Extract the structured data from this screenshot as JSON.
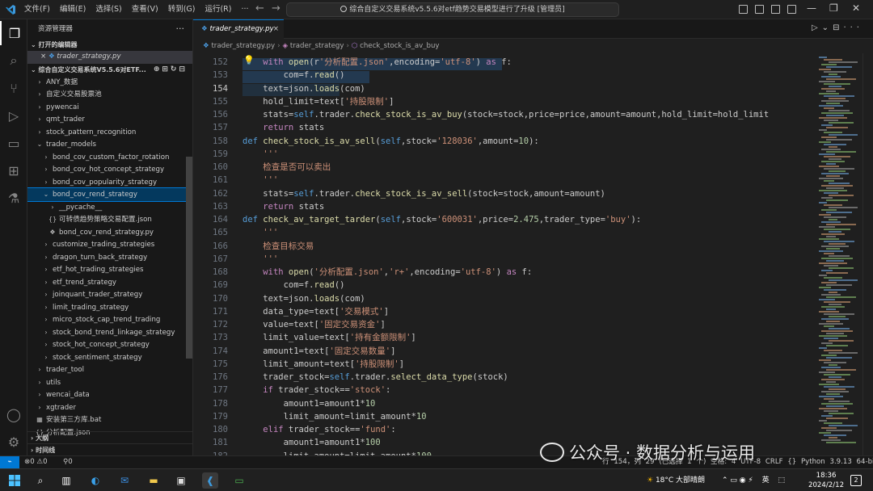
{
  "menu": [
    "文件(F)",
    "编辑(E)",
    "选择(S)",
    "查看(V)",
    "转到(G)",
    "运行(R)",
    "···"
  ],
  "command_center": "综合自定义交易系统v5.5.6对etf趋势交易模型进行了升级 [管理员]",
  "sidebar": {
    "title": "资源管理器",
    "open_editors_header": "打开的编辑器",
    "open_editor_file": "trader_strategy.py",
    "workspace_header": "综合自定义交易系统V5.5.6对ETF...",
    "tree": [
      {
        "label": "ANY_数据",
        "indent": 2,
        "kind": "folder",
        "chev": "›"
      },
      {
        "label": "自定义交易股票池",
        "indent": 2,
        "kind": "folder",
        "chev": "›"
      },
      {
        "label": "pywencai",
        "indent": 2,
        "kind": "folder",
        "chev": "›"
      },
      {
        "label": "qmt_trader",
        "indent": 2,
        "kind": "folder",
        "chev": "›"
      },
      {
        "label": "stock_pattern_recognition",
        "indent": 2,
        "kind": "folder",
        "chev": "›"
      },
      {
        "label": "trader_models",
        "indent": 2,
        "kind": "folder",
        "chev": "⌄"
      },
      {
        "label": "bond_cov_custom_factor_rotation",
        "indent": 3,
        "kind": "folder",
        "chev": "›"
      },
      {
        "label": "bond_cov_hot_concept_strategy",
        "indent": 3,
        "kind": "folder",
        "chev": "›"
      },
      {
        "label": "bond_cov_popularity_strategy",
        "indent": 3,
        "kind": "folder",
        "chev": "›"
      },
      {
        "label": "bond_cov_rend_strategy",
        "indent": 3,
        "kind": "folder",
        "chev": "⌄",
        "state": "sel"
      },
      {
        "label": "__pycache__",
        "indent": 4,
        "kind": "folder",
        "chev": "›"
      },
      {
        "label": "可转债趋势策略交易配置.json",
        "indent": 4,
        "kind": "json",
        "chev": ""
      },
      {
        "label": "bond_cov_rend_strategy.py",
        "indent": 4,
        "kind": "py",
        "chev": ""
      },
      {
        "label": "customize_trading_strategies",
        "indent": 3,
        "kind": "folder",
        "chev": "›"
      },
      {
        "label": "dragon_turn_back_strategy",
        "indent": 3,
        "kind": "folder",
        "chev": "›"
      },
      {
        "label": "etf_hot_trading_strategies",
        "indent": 3,
        "kind": "folder",
        "chev": "›"
      },
      {
        "label": "etf_trend_strategy",
        "indent": 3,
        "kind": "folder",
        "chev": "›"
      },
      {
        "label": "joinquant_trader_strategy",
        "indent": 3,
        "kind": "folder",
        "chev": "›"
      },
      {
        "label": "limit_trading_strategy",
        "indent": 3,
        "kind": "folder",
        "chev": "›"
      },
      {
        "label": "micro_stock_cap_trend_trading",
        "indent": 3,
        "kind": "folder",
        "chev": "›"
      },
      {
        "label": "stock_bond_trend_linkage_strategy",
        "indent": 3,
        "kind": "folder",
        "chev": "›"
      },
      {
        "label": "stock_hot_concept_strategy",
        "indent": 3,
        "kind": "folder",
        "chev": "›"
      },
      {
        "label": "stock_sentiment_strategy",
        "indent": 3,
        "kind": "folder",
        "chev": "›"
      },
      {
        "label": "trader_tool",
        "indent": 2,
        "kind": "folder",
        "chev": "›"
      },
      {
        "label": "utils",
        "indent": 2,
        "kind": "folder",
        "chev": "›"
      },
      {
        "label": "wencai_data",
        "indent": 2,
        "kind": "folder",
        "chev": "›"
      },
      {
        "label": "xgtrader",
        "indent": 2,
        "kind": "folder",
        "chev": "›"
      },
      {
        "label": "安装第三方库.bat",
        "indent": 2,
        "kind": "bat",
        "chev": ""
      },
      {
        "label": "分析配置.json",
        "indent": 2,
        "kind": "json",
        "chev": ""
      }
    ],
    "outline_header": "大纲",
    "timeline_header": "时间线"
  },
  "tab": {
    "label": "trader_strategy.py",
    "close": "×"
  },
  "breadcrumbs": [
    "trader_strategy.py",
    "trader_strategy",
    "check_stock_is_av_buy"
  ],
  "editor": {
    "current_line": 154,
    "lines": [
      {
        "n": 152,
        "t": [
          [
            "    ",
            ""
          ],
          [
            "with ",
            "k2"
          ],
          [
            "open",
            "f"
          ],
          [
            "(r",
            ""
          ],
          [
            "'分析配置.json'",
            "s"
          ],
          [
            ",encoding=",
            ""
          ],
          [
            "'utf-8'",
            "s"
          ],
          [
            ") ",
            ""
          ],
          [
            "as ",
            "k2"
          ],
          [
            "f:",
            ""
          ]
        ]
      },
      {
        "n": 153,
        "t": [
          [
            "        com=f.",
            ""
          ],
          [
            "read",
            "f"
          ],
          [
            "()",
            ""
          ]
        ]
      },
      {
        "n": 154,
        "t": [
          [
            "    text=json.",
            ""
          ],
          [
            "loads",
            "f"
          ],
          [
            "(com)",
            ""
          ]
        ]
      },
      {
        "n": 155,
        "t": [
          [
            "    hold_limit=text[",
            ""
          ],
          [
            "'持股限制'",
            "s"
          ],
          [
            "]",
            ""
          ]
        ]
      },
      {
        "n": 156,
        "t": [
          [
            "    stats=",
            ""
          ],
          [
            "self",
            "k"
          ],
          [
            ".trader.",
            ""
          ],
          [
            "check_stock_is_av_buy",
            "f"
          ],
          [
            "(stock=stock,price=price,amount=amount,hold_limit=hold_limit",
            ""
          ]
        ]
      },
      {
        "n": 157,
        "t": [
          [
            "    ",
            ""
          ],
          [
            "return ",
            "k2"
          ],
          [
            "stats",
            ""
          ]
        ]
      },
      {
        "n": 158,
        "t": [
          [
            "def ",
            "k"
          ],
          [
            "check_stock_is_av_sell",
            "f"
          ],
          [
            "(",
            ""
          ],
          [
            "self",
            "k"
          ],
          [
            ",stock=",
            ""
          ],
          [
            "'128036'",
            "s"
          ],
          [
            ",amount=",
            ""
          ],
          [
            "10",
            "n"
          ],
          [
            "):",
            ""
          ]
        ]
      },
      {
        "n": 159,
        "t": [
          [
            "    '''",
            "s"
          ]
        ]
      },
      {
        "n": 160,
        "t": [
          [
            "    检查是否可以卖出",
            "s"
          ]
        ]
      },
      {
        "n": 161,
        "t": [
          [
            "    '''",
            "s"
          ]
        ]
      },
      {
        "n": 162,
        "t": [
          [
            "    stats=",
            ""
          ],
          [
            "self",
            "k"
          ],
          [
            ".trader.",
            ""
          ],
          [
            "check_stock_is_av_sell",
            "f"
          ],
          [
            "(stock=stock,amount=amount)",
            ""
          ]
        ]
      },
      {
        "n": 163,
        "t": [
          [
            "    ",
            ""
          ],
          [
            "return ",
            "k2"
          ],
          [
            "stats",
            ""
          ]
        ]
      },
      {
        "n": 164,
        "t": [
          [
            "def ",
            "k"
          ],
          [
            "check_av_target_tarder",
            "f"
          ],
          [
            "(",
            ""
          ],
          [
            "self",
            "k"
          ],
          [
            ",stock=",
            ""
          ],
          [
            "'600031'",
            "s"
          ],
          [
            ",price=",
            ""
          ],
          [
            "2.475",
            "n"
          ],
          [
            ",trader_type=",
            ""
          ],
          [
            "'buy'",
            "s"
          ],
          [
            "):",
            ""
          ]
        ]
      },
      {
        "n": 165,
        "t": [
          [
            "    '''",
            "s"
          ]
        ]
      },
      {
        "n": 166,
        "t": [
          [
            "    检查目标交易",
            "s"
          ]
        ]
      },
      {
        "n": 167,
        "t": [
          [
            "    '''",
            "s"
          ]
        ]
      },
      {
        "n": 168,
        "t": [
          [
            "    ",
            ""
          ],
          [
            "with ",
            "k2"
          ],
          [
            "open",
            "f"
          ],
          [
            "(",
            ""
          ],
          [
            "'分析配置.json'",
            "s"
          ],
          [
            ",",
            ""
          ],
          [
            "'r+'",
            "s"
          ],
          [
            ",encoding=",
            ""
          ],
          [
            "'utf-8'",
            "s"
          ],
          [
            ") ",
            ""
          ],
          [
            "as ",
            "k2"
          ],
          [
            "f:",
            ""
          ]
        ]
      },
      {
        "n": 169,
        "t": [
          [
            "        com=f.",
            ""
          ],
          [
            "read",
            "f"
          ],
          [
            "()",
            ""
          ]
        ]
      },
      {
        "n": 170,
        "t": [
          [
            "    text=json.",
            ""
          ],
          [
            "loads",
            "f"
          ],
          [
            "(com)",
            ""
          ]
        ]
      },
      {
        "n": 171,
        "t": [
          [
            "    data_type=text[",
            ""
          ],
          [
            "'交易模式'",
            "s"
          ],
          [
            "]",
            ""
          ]
        ]
      },
      {
        "n": 172,
        "t": [
          [
            "    value=text[",
            ""
          ],
          [
            "'固定交易资金'",
            "s"
          ],
          [
            "]",
            ""
          ]
        ]
      },
      {
        "n": 173,
        "t": [
          [
            "    limit_value=text[",
            ""
          ],
          [
            "'持有金额限制'",
            "s"
          ],
          [
            "]",
            ""
          ]
        ]
      },
      {
        "n": 174,
        "t": [
          [
            "    amount1=text[",
            ""
          ],
          [
            "'固定交易数量'",
            "s"
          ],
          [
            "]",
            ""
          ]
        ]
      },
      {
        "n": 175,
        "t": [
          [
            "    limit_amount=text[",
            ""
          ],
          [
            "'持股限制'",
            "s"
          ],
          [
            "]",
            ""
          ]
        ]
      },
      {
        "n": 176,
        "t": [
          [
            "    trader_stock=",
            ""
          ],
          [
            "self",
            "k"
          ],
          [
            ".trader.",
            ""
          ],
          [
            "select_data_type",
            "f"
          ],
          [
            "(stock)",
            ""
          ]
        ]
      },
      {
        "n": 177,
        "t": [
          [
            "    ",
            ""
          ],
          [
            "if ",
            "k2"
          ],
          [
            "trader_stock==",
            ""
          ],
          [
            "'stock'",
            "s"
          ],
          [
            ":",
            ""
          ]
        ]
      },
      {
        "n": 178,
        "t": [
          [
            "        amount1=amount1*",
            ""
          ],
          [
            "10",
            "n"
          ]
        ]
      },
      {
        "n": 179,
        "t": [
          [
            "        limit_amount=limit_amount*",
            ""
          ],
          [
            "10",
            "n"
          ]
        ]
      },
      {
        "n": 180,
        "t": [
          [
            "    ",
            ""
          ],
          [
            "elif ",
            "k2"
          ],
          [
            "trader_stock==",
            ""
          ],
          [
            "'fund'",
            "s"
          ],
          [
            ":",
            ""
          ]
        ]
      },
      {
        "n": 181,
        "t": [
          [
            "        amount1=amount1*",
            ""
          ],
          [
            "100",
            "n"
          ]
        ]
      },
      {
        "n": 182,
        "t": [
          [
            "        limit_amount=limit_amount*",
            ""
          ],
          [
            "100",
            "n"
          ]
        ]
      }
    ]
  },
  "statusbar": {
    "problems": "⊗0 ⚠0",
    "ports": "⚲0",
    "right": "行 154，列 29 (已选择 1 个)  空格: 4  UTF-8  CRLF  {} Python  3.9.13 64-bit"
  },
  "watermark": "公众号 · 数据分析与运用",
  "taskbar": {
    "weather": "18°C 大部晴朗",
    "ime": "英",
    "time": "18:36",
    "date": "2024/2/12",
    "notifications": "2"
  },
  "colors": {
    "accent": "#0078d4",
    "selection": "#04395e",
    "editor_bg": "#1f1f1f"
  }
}
